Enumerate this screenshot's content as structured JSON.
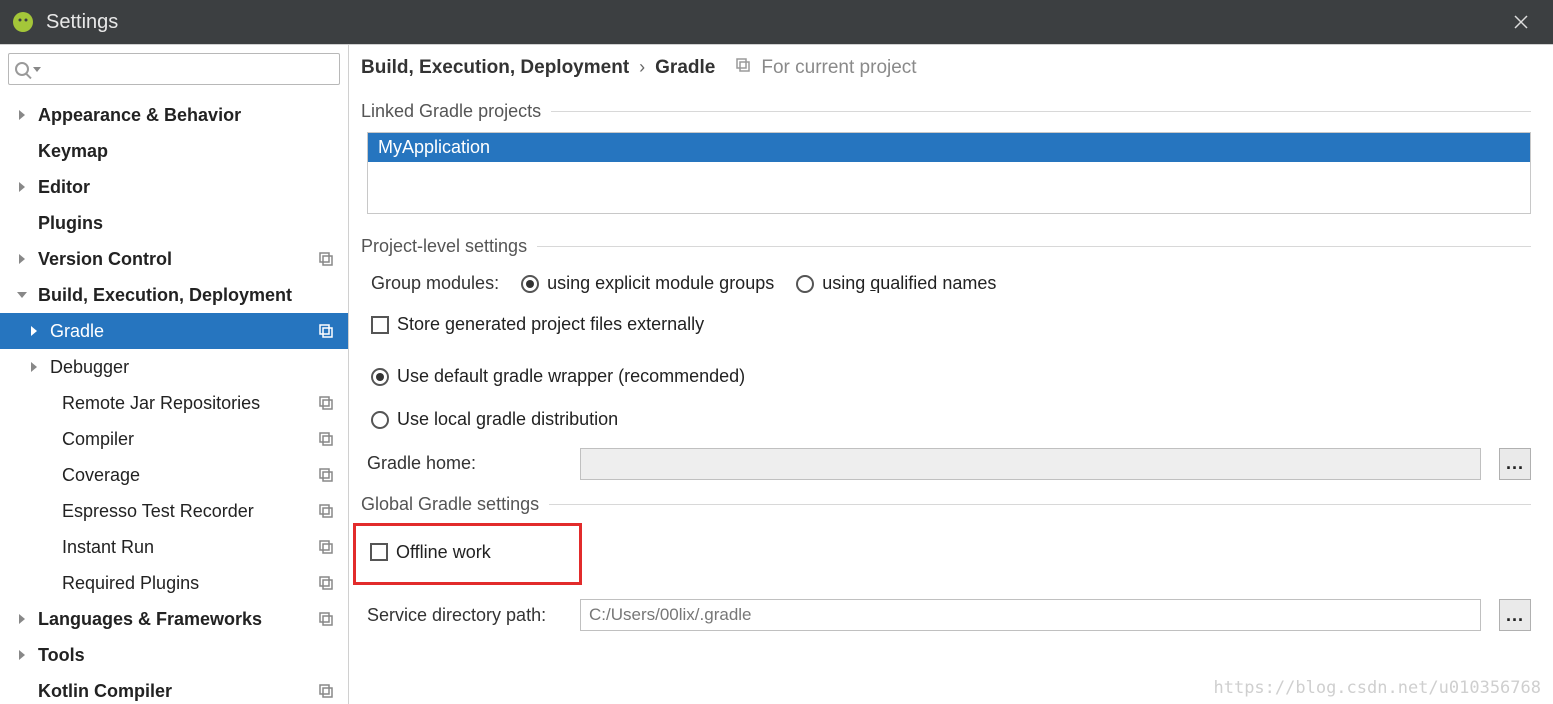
{
  "title": "Settings",
  "search": {
    "placeholder": ""
  },
  "sidebar": {
    "items": [
      {
        "label": "Appearance & Behavior",
        "level": 1,
        "chev": "right",
        "copy": false
      },
      {
        "label": "Keymap",
        "level": 1,
        "chev": "none",
        "copy": false
      },
      {
        "label": "Editor",
        "level": 1,
        "chev": "right",
        "copy": false
      },
      {
        "label": "Plugins",
        "level": 1,
        "chev": "none",
        "copy": false
      },
      {
        "label": "Version Control",
        "level": 1,
        "chev": "right",
        "copy": true
      },
      {
        "label": "Build, Execution, Deployment",
        "level": 1,
        "chev": "down",
        "copy": false
      },
      {
        "label": "Gradle",
        "level": 2,
        "chev": "right",
        "copy": true,
        "selected": true
      },
      {
        "label": "Debugger",
        "level": 2,
        "chev": "right",
        "copy": false
      },
      {
        "label": "Remote Jar Repositories",
        "level": 3,
        "chev": "none",
        "copy": true
      },
      {
        "label": "Compiler",
        "level": 3,
        "chev": "none",
        "copy": true
      },
      {
        "label": "Coverage",
        "level": 3,
        "chev": "none",
        "copy": true
      },
      {
        "label": "Espresso Test Recorder",
        "level": 3,
        "chev": "none",
        "copy": true
      },
      {
        "label": "Instant Run",
        "level": 3,
        "chev": "none",
        "copy": true
      },
      {
        "label": "Required Plugins",
        "level": 3,
        "chev": "none",
        "copy": true
      },
      {
        "label": "Languages & Frameworks",
        "level": 1,
        "chev": "right",
        "copy": true
      },
      {
        "label": "Tools",
        "level": 1,
        "chev": "right",
        "copy": false
      },
      {
        "label": "Kotlin Compiler",
        "level": 1,
        "chev": "none",
        "copy": true
      }
    ]
  },
  "breadcrumb": {
    "crumb1": "Build, Execution, Deployment",
    "sep": "›",
    "crumb2": "Gradle",
    "scope": "For current project"
  },
  "sections": {
    "linked": "Linked Gradle projects",
    "project": "Project-level settings",
    "global": "Global Gradle settings"
  },
  "linked_project": "MyApplication",
  "group_modules": {
    "label": "Group modules:",
    "opt1": "using explicit module groups",
    "opt2": "using qualified names"
  },
  "store_external": "Store generated project files externally",
  "use_default_wrapper": "Use default gradle wrapper (recommended)",
  "use_local": "Use local gradle distribution",
  "gradle_home_label": "Gradle home:",
  "gradle_home_value": "",
  "offline_work": "Offline work",
  "service_dir_label": "Service directory path:",
  "service_dir_value": "C:/Users/00lix/.gradle",
  "browse_label": "...",
  "watermark": "https://blog.csdn.net/u010356768"
}
